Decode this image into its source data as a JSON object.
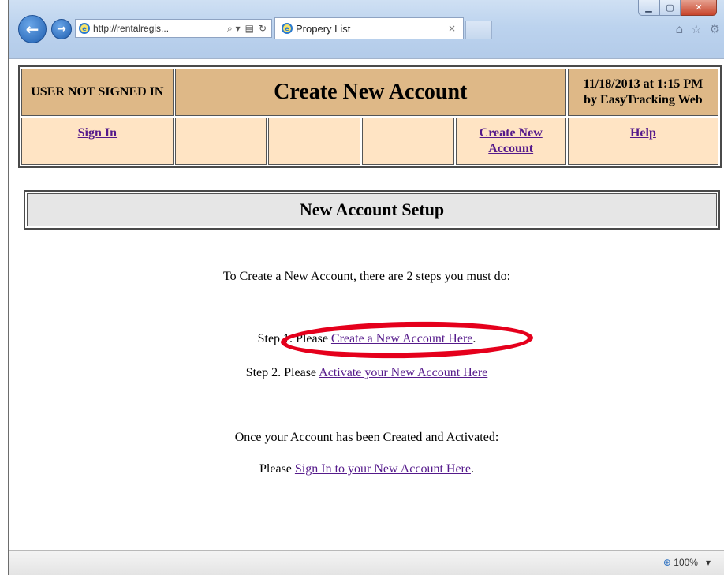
{
  "browser": {
    "url": "http://rentalregis...",
    "tab_title": "Propery List",
    "address_tools": [
      "⌕ ▾",
      "▤",
      "↻"
    ],
    "window_buttons": {
      "minimize": "▁",
      "maximize": "▢",
      "close": "✕"
    },
    "nav": {
      "back": "←",
      "forward": "→"
    },
    "tab_close": "×",
    "toolbar_icons": [
      "⌂",
      "☆",
      "⚙"
    ],
    "zoom": "100%",
    "zoom_icon": "⊕",
    "zoom_menu": "▾"
  },
  "header": {
    "user_status": "USER NOT SIGNED IN",
    "title": "Create New Account",
    "date_line1": "11/18/2013 at 1:15 PM",
    "date_line2": "by EasyTracking Web"
  },
  "menu": {
    "sign_in": "Sign In",
    "create_line1": "Create New",
    "create_line2": "Account",
    "help": "Help"
  },
  "main": {
    "section_title": "New Account Setup",
    "intro": "To Create a New Account, there are 2 steps you must do:",
    "step1_prefix": "Step 1. Please ",
    "step1_link": "Create a New Account Here",
    "step1_suffix": ".",
    "step2_prefix": "Step 2. Please ",
    "step2_link": "Activate your New Account Here",
    "once_text": "Once your Account has been Created and Activated:",
    "signin_prefix": "Please ",
    "signin_link": "Sign In to your New Account Here",
    "signin_suffix": "."
  },
  "colors": {
    "header_bg": "#deb887",
    "menu_bg": "#ffe4c4",
    "link": "#551a8b",
    "highlight": "#e5001c"
  }
}
